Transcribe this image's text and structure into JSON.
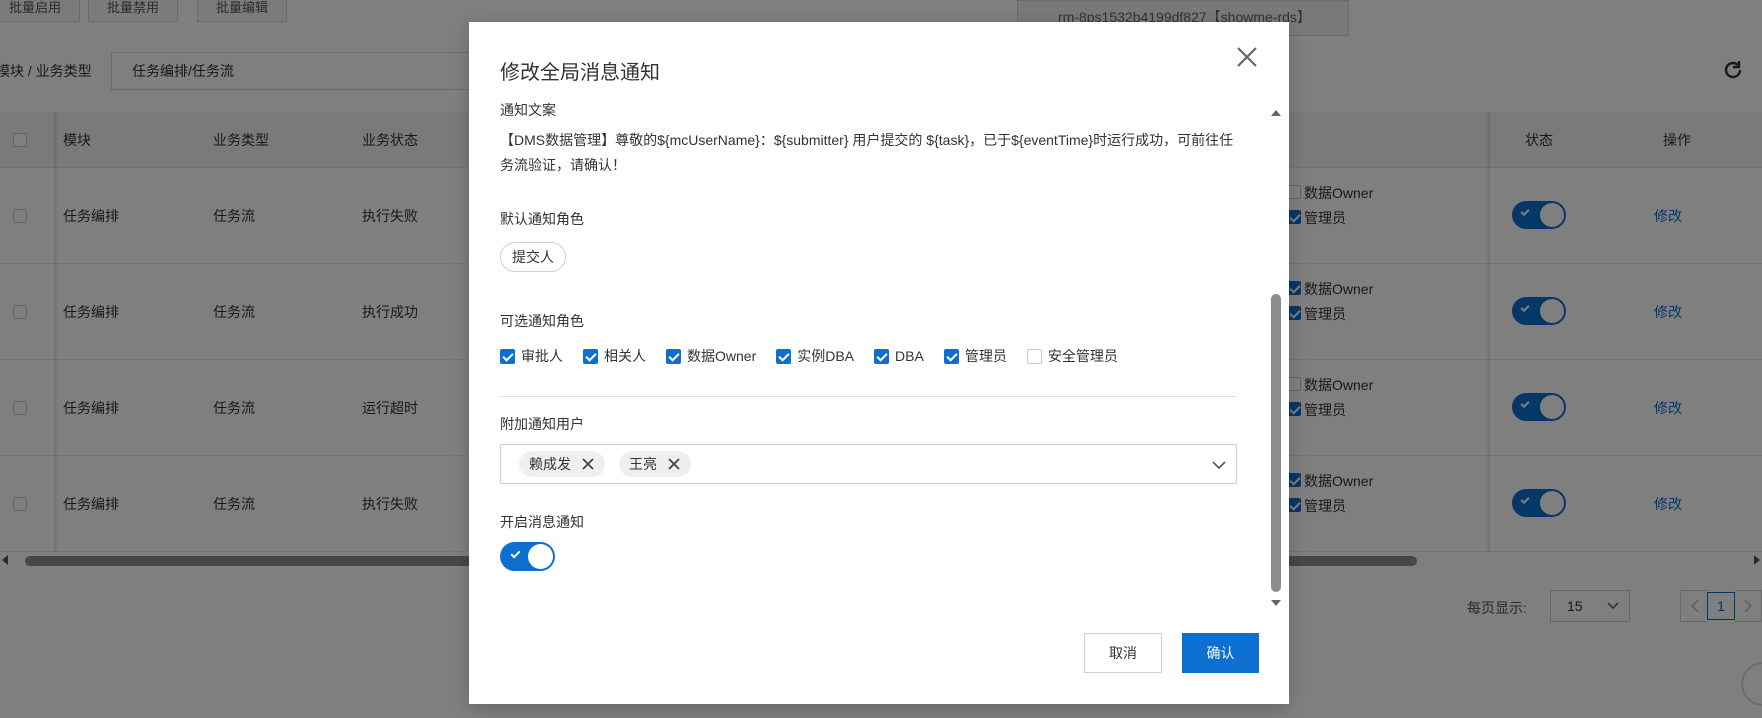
{
  "background": {
    "toolbar_buttons": [
      "批量启用",
      "批量禁用",
      "批量编辑"
    ],
    "rds_instance": "rm-8ps1532b4199df827【showme-rds】",
    "filter": {
      "label": "模块 / 业务类型",
      "value": "任务编排/任务流"
    },
    "table": {
      "headers": {
        "module": "模块",
        "biz_type": "业务类型",
        "biz_status": "业务状态",
        "status": "状态",
        "action": "操作"
      },
      "rows": [
        {
          "module": "任务编排",
          "biz_type": "任务流",
          "biz_status": "执行失败",
          "role1": "数据Owner",
          "role1_checked": false,
          "role2": "管理员",
          "role2_checked": true,
          "action": "修改"
        },
        {
          "module": "任务编排",
          "biz_type": "任务流",
          "biz_status": "执行成功",
          "role1": "数据Owner",
          "role1_checked": true,
          "role2": "管理员",
          "role2_checked": true,
          "action": "修改"
        },
        {
          "module": "任务编排",
          "biz_type": "任务流",
          "biz_status": "运行超时",
          "role1": "数据Owner",
          "role1_checked": false,
          "role2": "管理员",
          "role2_checked": true,
          "action": "修改"
        },
        {
          "module": "任务编排",
          "biz_type": "任务流",
          "biz_status": "执行失败",
          "role1": "数据Owner",
          "role1_checked": true,
          "role2": "管理员",
          "role2_checked": true,
          "action": "修改"
        }
      ]
    },
    "pagination": {
      "page_size_label": "每页显示:",
      "page_size": "15",
      "current_page": "1"
    }
  },
  "dialog": {
    "title": "修改全局消息通知",
    "message_label": "通知文案",
    "message_text": "【DMS数据管理】尊敬的${mcUserName}：${submitter} 用户提交的 ${task}，已于${eventTime}时运行成功，可前往任务流验证，请确认！",
    "default_roles_label": "默认通知角色",
    "default_roles": [
      "提交人"
    ],
    "optional_roles_label": "可选通知角色",
    "optional_roles": [
      {
        "label": "审批人",
        "checked": true
      },
      {
        "label": "相关人",
        "checked": true
      },
      {
        "label": "数据Owner",
        "checked": true
      },
      {
        "label": "实例DBA",
        "checked": true
      },
      {
        "label": "DBA",
        "checked": true
      },
      {
        "label": "管理员",
        "checked": true
      },
      {
        "label": "安全管理员",
        "checked": false
      }
    ],
    "extra_users_label": "附加通知用户",
    "extra_users": [
      "赖成发",
      "王亮"
    ],
    "enable_label": "开启消息通知",
    "enabled": true,
    "cancel_label": "取消",
    "ok_label": "确认"
  },
  "colors": {
    "primary": "#0d6fcf",
    "mask": "rgba(0,0,0,0.5)"
  }
}
